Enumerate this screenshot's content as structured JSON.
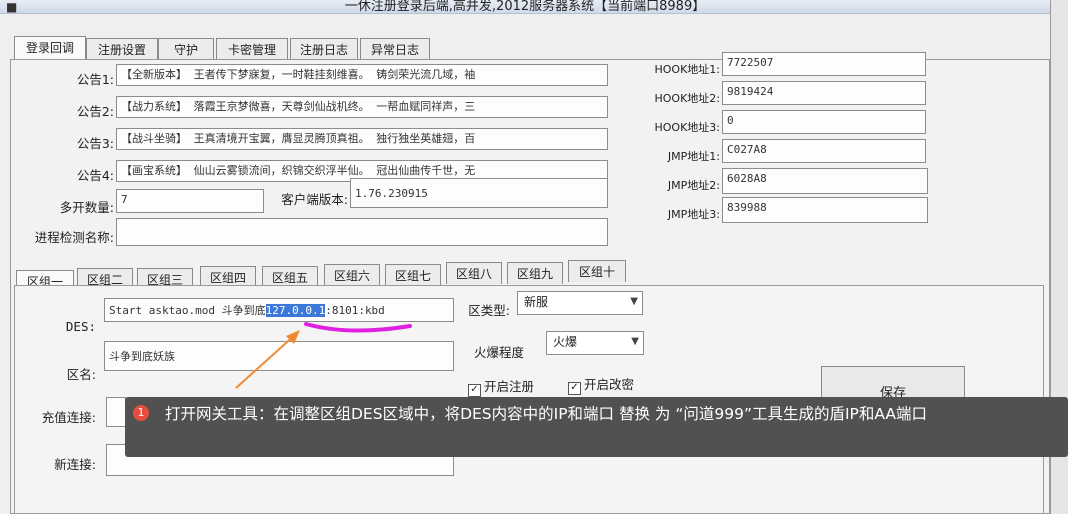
{
  "window": {
    "title": "一休注册登录后端,高并发,2012服务器系统【当前端口8989】",
    "icon": "app-icon"
  },
  "main_tabs": [
    "登录回调",
    "注册设置",
    "守护",
    "卡密管理",
    "注册日志",
    "异常日志"
  ],
  "announcements": [
    {
      "label": "公告1:",
      "value": "【全新版本】  王者传下梦寐复，一时鞋挂刻维喜。 铸剑荣光流几域，袖"
    },
    {
      "label": "公告2:",
      "value": "【战力系统】  落霞王京梦微喜，天尊剑仙战机终。 一帮血赋同祥声，三"
    },
    {
      "label": "公告3:",
      "value": "【战斗坐骑】  王真清境开宝翼，膺显灵腾顶真祖。 独行独坐英雄翅，百"
    },
    {
      "label": "公告4:",
      "value": "【画宝系统】  仙山云雾锁流间，织锦交织浮半仙。 冠出仙曲传千世，无"
    }
  ],
  "multi_open": {
    "label": "多开数量:",
    "value": "7"
  },
  "client_version": {
    "label": "客户端版本:",
    "value": "1.76.230915"
  },
  "process_detect": {
    "label": "进程检测名称:",
    "value": ""
  },
  "hook": [
    {
      "label": "HOOK地址1:",
      "value": "7722507"
    },
    {
      "label": "HOOK地址2:",
      "value": "9819424"
    },
    {
      "label": "HOOK地址3:",
      "value": "0"
    }
  ],
  "jmp": [
    {
      "label": "JMP地址1:",
      "value": "C027A8"
    },
    {
      "label": "JMP地址2:",
      "value": "6028A8"
    },
    {
      "label": "JMP地址3:",
      "value": "839988"
    }
  ],
  "zone_tabs": [
    "区组一",
    "区组二",
    "区组三",
    "区组四",
    "区组五",
    "区组六",
    "区组七",
    "区组八",
    "区组九",
    "区组十"
  ],
  "zone": {
    "des_label": "DES:",
    "des_prefix": "Start asktao.mod 斗争到底",
    "des_ip": "127.0.0.1",
    "des_suffix": ":8101:kbd",
    "name_label": "区名:",
    "name_value": "斗争到底妖族",
    "recharge_label": "充值连接:",
    "recharge_value": "",
    "new_label": "新连接:",
    "new_value": "",
    "type_label": "区类型:",
    "type_value": "新服",
    "hot_label": "火爆程度",
    "hot_value": "火爆",
    "enable_register": "开启注册",
    "enable_password": "开启改密",
    "save_button": "保存"
  },
  "tooltip": {
    "step": "1",
    "text": "打开网关工具：在调整区组DES区域中，将DES内容中的IP和端口 替换 为 “问道999”工具生成的盾IP和AA端口"
  },
  "colors": {
    "highlight": "#3b78d8",
    "annotation_underline": "#e020e0",
    "arrow": "#f08a30",
    "tooltip_bg": "#515151",
    "badge": "#e74c3c"
  }
}
